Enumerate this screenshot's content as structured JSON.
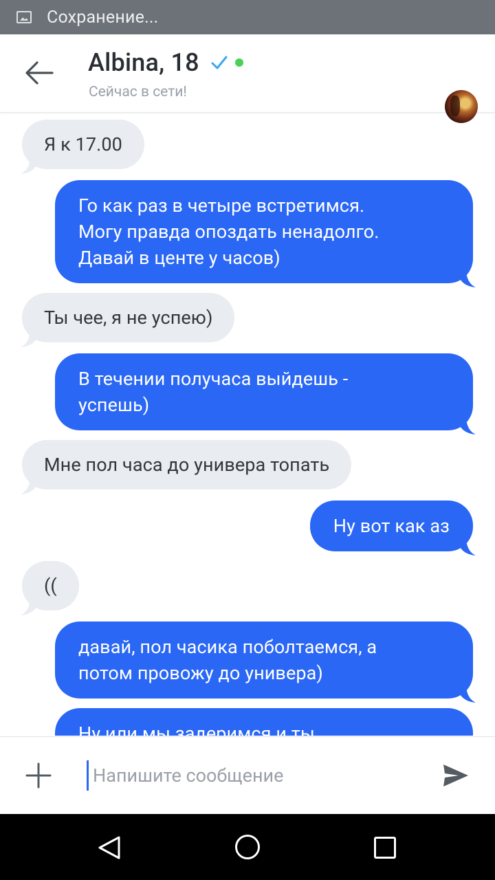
{
  "status_bar": {
    "notification_text": "Сохранение..."
  },
  "header": {
    "name": "Albina, 18",
    "status": "Сейчас в сети!",
    "verified": true,
    "online_color": "#4cd057"
  },
  "messages": [
    {
      "from": "them",
      "text": "Я к 17.00"
    },
    {
      "from": "me",
      "text": "Го как раз в четыре встретимся.\nМогу правда опоздать ненадолго.\nДавай в центе у часов)"
    },
    {
      "from": "them",
      "text": "Ты чее, я не успею)"
    },
    {
      "from": "me",
      "text": "В течении получаса выйдешь -\nуспешь)"
    },
    {
      "from": "them",
      "text": "Мне пол часа до универа топать"
    },
    {
      "from": "me",
      "text": "Ну вот как аз"
    },
    {
      "from": "them",
      "text": "(("
    },
    {
      "from": "me",
      "text": "давай, пол часика поболтаемся, а\nпотом провожу до универа)"
    },
    {
      "from": "me",
      "text": "Ну или мы задеримся и ты"
    }
  ],
  "composer": {
    "placeholder": "Напишите сообщение"
  },
  "colors": {
    "outgoing": "#2a67f5",
    "incoming": "#e9ecf0",
    "accent": "#2a67f5"
  },
  "icons": {
    "back": "arrow-left-icon",
    "verified": "check-icon",
    "attach": "plus-icon",
    "send": "send-icon",
    "nav_back": "triangle-back-icon",
    "nav_home": "circle-home-icon",
    "nav_recent": "square-recent-icon"
  }
}
